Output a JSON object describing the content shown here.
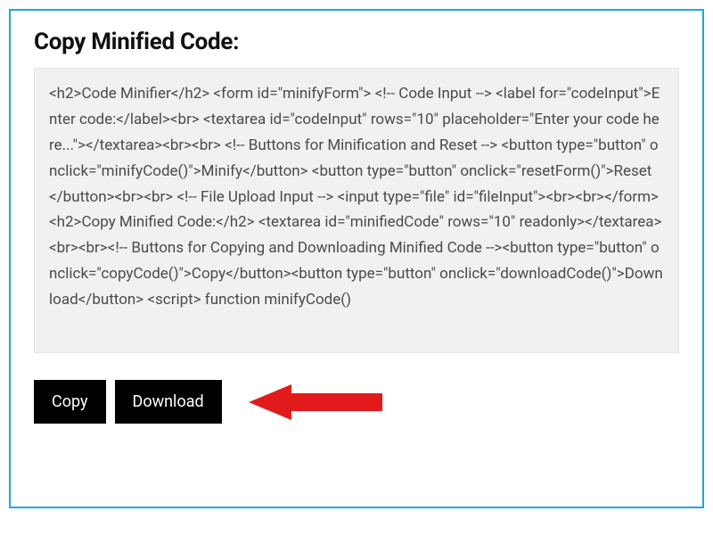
{
  "heading": "Copy Minified Code:",
  "minified_code": "<h2>Code Minifier</h2> <form id=\"minifyForm\"> <!-- Code Input --> <label for=\"codeInput\">Enter code:</label><br> <textarea id=\"codeInput\" rows=\"10\" placeholder=\"Enter your code here...\"></textarea><br><br> <!-- Buttons for Minification and Reset --> <button type=\"button\" onclick=\"minifyCode()\">Minify</button> <button type=\"button\" onclick=\"resetForm()\">Reset</button><br><br> <!-- File Upload Input --> <input type=\"file\" id=\"fileInput\"><br><br></form><h2>Copy Minified Code:</h2> <textarea id=\"minifiedCode\" rows=\"10\" readonly></textarea><br><br><!-- Buttons for Copying and Downloading Minified Code --><button type=\"button\" onclick=\"copyCode()\">Copy</button><button type=\"button\" onclick=\"downloadCode()\">Download</button> <script> function minifyCode()",
  "buttons": {
    "copy_label": "Copy",
    "download_label": "Download"
  },
  "colors": {
    "panel_border": "#1ba8dc",
    "code_bg": "#f1f1f1",
    "button_bg": "#000000",
    "button_text": "#ffffff",
    "arrow": "#e11b1b"
  }
}
